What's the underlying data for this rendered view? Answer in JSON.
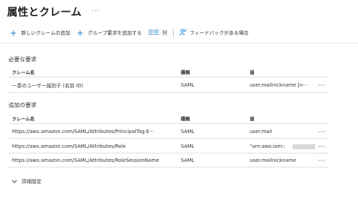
{
  "page": {
    "title": "属性とクレーム",
    "more": "···"
  },
  "toolbar": {
    "add_claim": "新しいクレームの追加",
    "add_group": "グループ要求を追加する",
    "columns": "列",
    "feedback": "フィードバックがある場合",
    "icons": {
      "add": "plus-icon",
      "columns": "list-columns-icon",
      "feedback": "feedback-person-icon"
    }
  },
  "required": {
    "title": "必要な要求",
    "headers": {
      "name": "クレーム名",
      "type": "種類",
      "value": "値"
    },
    "rows": [
      {
        "name": "一意のユーザー識別子 (名前 ID)",
        "type": "SAML",
        "value": "user.mailnickname [n···"
      }
    ]
  },
  "additional": {
    "title": "追加の要求",
    "headers": {
      "name": "クレーム名",
      "type": "種類",
      "value": "値"
    },
    "rows": [
      {
        "name": "https://aws.amazon.com/SAML/Attributes/PrincipalTag:E···",
        "type": "SAML",
        "value": "user.mail"
      },
      {
        "name": "https://aws.amazon.com/SAML/Attributes/Role",
        "type": "SAML",
        "value": "\"arn:aws:iam::"
      },
      {
        "name": "https://aws.amazon.com/SAML/Attributes/RoleSessionName",
        "type": "SAML",
        "value": "user.mailnickname"
      }
    ]
  },
  "row_more": "···",
  "advanced": {
    "label": "詳細設定"
  },
  "colors": {
    "accent": "#0078d4",
    "text": "#323130",
    "divider": "#e1dfdd"
  }
}
